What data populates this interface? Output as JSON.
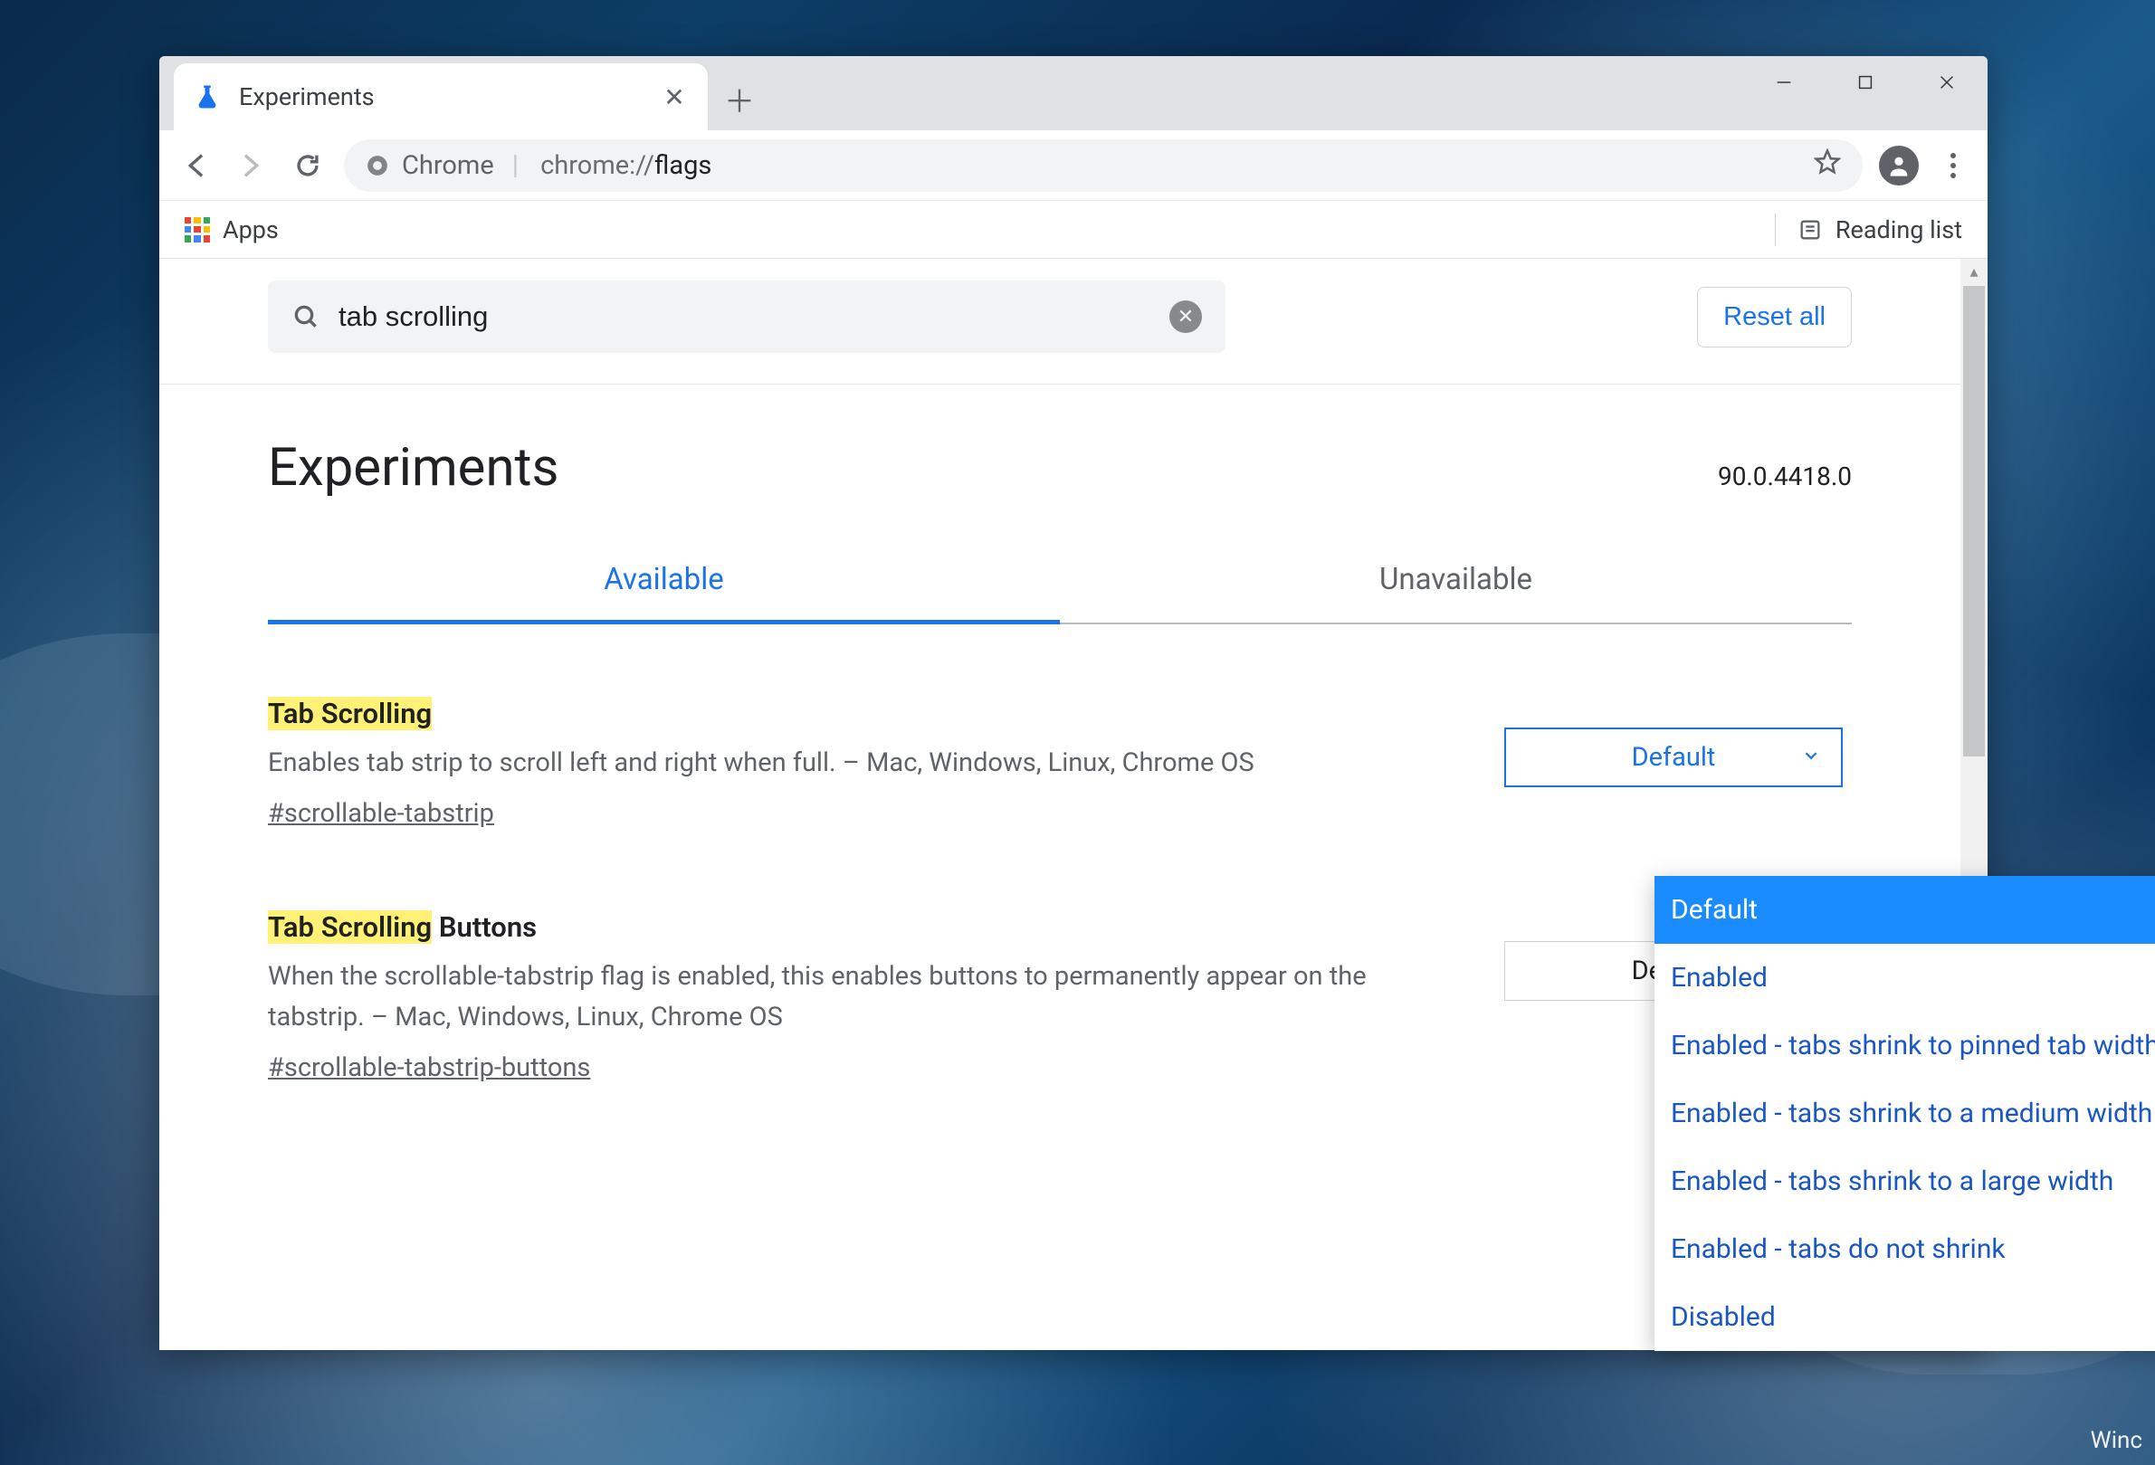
{
  "window": {
    "tab_title": "Experiments"
  },
  "omnibox": {
    "origin_label": "Chrome",
    "url_prefix": "chrome://",
    "url_path": "flags"
  },
  "bookmarks": {
    "apps_label": "Apps",
    "reading_list_label": "Reading list"
  },
  "flags": {
    "search_value": "tab scrolling",
    "reset_label": "Reset all",
    "heading": "Experiments",
    "version": "90.0.4418.0",
    "tabs": {
      "available": "Available",
      "unavailable": "Unavailable"
    },
    "items": [
      {
        "title_highlight": "Tab Scrolling",
        "title_suffix": "",
        "description": "Enables tab strip to scroll left and right when full. – Mac, Windows, Linux, Chrome OS",
        "anchor": "#scrollable-tabstrip",
        "selected": "Default"
      },
      {
        "title_highlight": "Tab Scrolling",
        "title_suffix": " Buttons",
        "description": "When the scrollable-tabstrip flag is enabled, this enables buttons to permanently appear on the tabstrip. – Mac, Windows, Linux, Chrome OS",
        "anchor": "#scrollable-tabstrip-buttons",
        "selected": "Default"
      }
    ],
    "dropdown_options": [
      "Default",
      "Enabled",
      "Enabled - tabs shrink to pinned tab width",
      "Enabled - tabs shrink to a medium width",
      "Enabled - tabs shrink to a large width",
      "Enabled - tabs do not shrink",
      "Disabled"
    ]
  },
  "watermark": "Winc"
}
